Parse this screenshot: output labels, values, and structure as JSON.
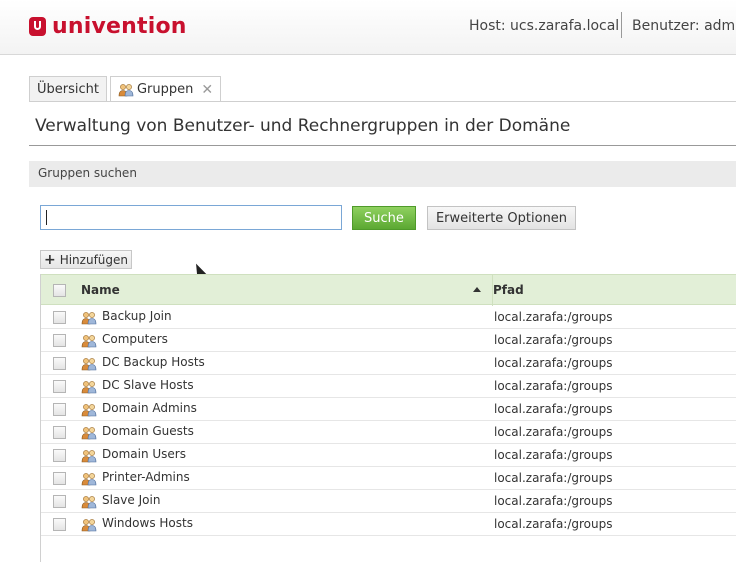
{
  "header": {
    "brand": "univention",
    "host": "Host: ucs.zarafa.local",
    "user": "Benutzer: admin"
  },
  "tabs": [
    {
      "label": "Übersicht"
    },
    {
      "label": "Gruppen",
      "close": "✕"
    }
  ],
  "page_title": "Verwaltung von Benutzer- und Rechnergruppen in der Domäne",
  "search": {
    "section_title": "Gruppen suchen",
    "value": "",
    "search_button": "Suche",
    "advanced_button": "Erweiterte Optionen"
  },
  "toolbar": {
    "add_button": "Hinzufügen"
  },
  "grid": {
    "columns": {
      "name": "Name",
      "path": "Pfad"
    },
    "sort": "name-ascending",
    "rows": [
      {
        "name": "Backup Join",
        "path": "local.zarafa:/groups"
      },
      {
        "name": "Computers",
        "path": "local.zarafa:/groups"
      },
      {
        "name": "DC Backup Hosts",
        "path": "local.zarafa:/groups"
      },
      {
        "name": "DC Slave Hosts",
        "path": "local.zarafa:/groups"
      },
      {
        "name": "Domain Admins",
        "path": "local.zarafa:/groups"
      },
      {
        "name": "Domain Guests",
        "path": "local.zarafa:/groups"
      },
      {
        "name": "Domain Users",
        "path": "local.zarafa:/groups"
      },
      {
        "name": "Printer-Admins",
        "path": "local.zarafa:/groups"
      },
      {
        "name": "Slave Join",
        "path": "local.zarafa:/groups"
      },
      {
        "name": "Windows Hosts",
        "path": "local.zarafa:/groups"
      }
    ]
  },
  "colors": {
    "brand": "#c8102e",
    "search_button": "#5ba832",
    "grid_header": "#e2efd7"
  }
}
